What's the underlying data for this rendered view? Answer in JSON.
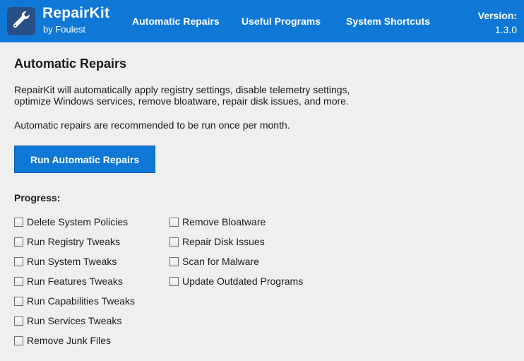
{
  "header": {
    "title": "RepairKit",
    "subtitle": "by Foulest",
    "nav": [
      {
        "label": "Automatic Repairs"
      },
      {
        "label": "Useful Programs"
      },
      {
        "label": "System Shortcuts"
      }
    ],
    "version_label": "Version:",
    "version_value": "1.3.0",
    "logo_icon": "wrench-icon",
    "colors": {
      "bar": "#0f78d7",
      "logo_bg": "#2a4f86"
    }
  },
  "main": {
    "heading": "Automatic Repairs",
    "description": "RepairKit will automatically apply registry settings, disable telemetry settings, optimize Windows services, remove bloatware, repair disk issues, and more.",
    "recommendation": "Automatic repairs are recommended to be run once per month.",
    "run_button": "Run Automatic Repairs",
    "progress_label": "Progress:",
    "progress_left": [
      {
        "label": "Delete System Policies",
        "checked": false
      },
      {
        "label": "Run Registry Tweaks",
        "checked": false
      },
      {
        "label": "Run System Tweaks",
        "checked": false
      },
      {
        "label": "Run Features Tweaks",
        "checked": false
      },
      {
        "label": "Run Capabilities Tweaks",
        "checked": false
      },
      {
        "label": "Run Services Tweaks",
        "checked": false
      },
      {
        "label": "Remove Junk Files",
        "checked": false
      }
    ],
    "progress_right": [
      {
        "label": "Remove Bloatware",
        "checked": false
      },
      {
        "label": "Repair Disk Issues",
        "checked": false
      },
      {
        "label": "Scan for Malware",
        "checked": false
      },
      {
        "label": "Update Outdated Programs",
        "checked": false
      }
    ]
  }
}
